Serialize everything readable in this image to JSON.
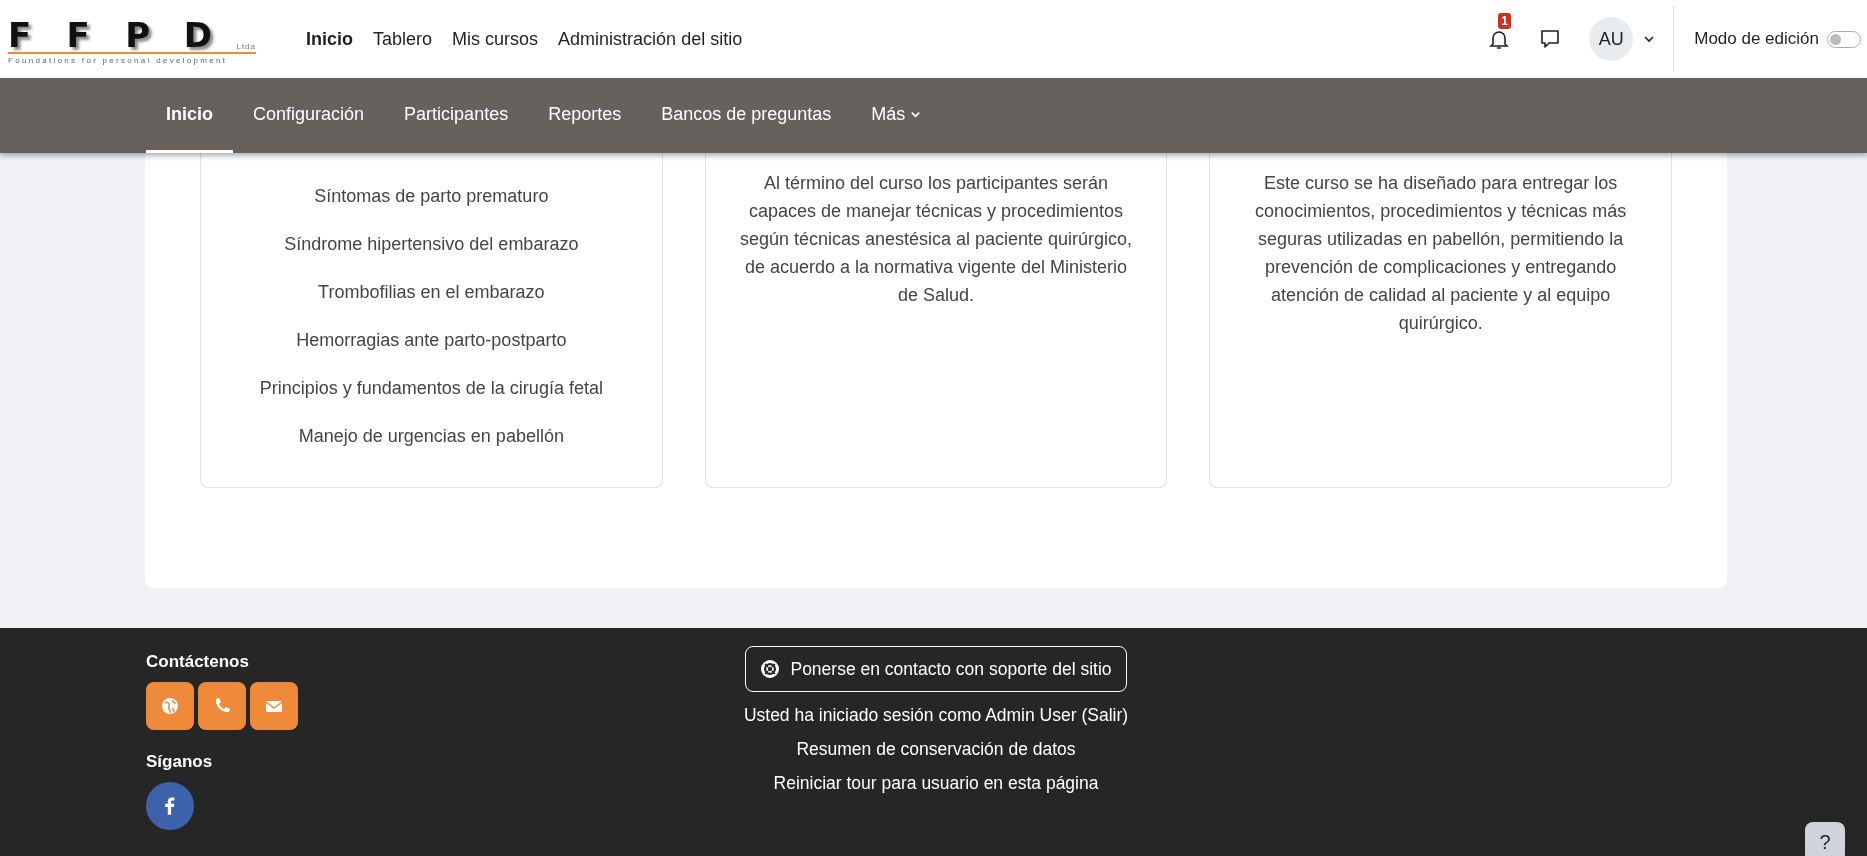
{
  "logo": {
    "letters": [
      "F",
      "F",
      "P",
      "D"
    ],
    "suffix": "Ltda",
    "tagline": "Foundations for personal development"
  },
  "primary_nav": [
    {
      "label": "Inicio",
      "selected": true
    },
    {
      "label": "Tablero",
      "selected": false
    },
    {
      "label": "Mis cursos",
      "selected": false
    },
    {
      "label": "Administración del sitio",
      "selected": false
    }
  ],
  "user_menu": {
    "notification_count": "1",
    "avatar": "AU",
    "edit_mode_label": "Modo de edición",
    "edit_mode_on": false
  },
  "secondary_nav": [
    {
      "label": "Inicio",
      "selected": true,
      "has_menu": false
    },
    {
      "label": "Configuración",
      "selected": false,
      "has_menu": false
    },
    {
      "label": "Participantes",
      "selected": false,
      "has_menu": false
    },
    {
      "label": "Reportes",
      "selected": false,
      "has_menu": false
    },
    {
      "label": "Bancos de preguntas",
      "selected": false,
      "has_menu": false
    },
    {
      "label": "Más",
      "selected": false,
      "has_menu": true
    }
  ],
  "cards": [
    {
      "kind": "list",
      "items": [
        "Síntomas de parto prematuro",
        "Síndrome hipertensivo del embarazo",
        "Trombofilias en el embarazo",
        "Hemorragias ante parto-postparto",
        "Principios y fundamentos de la cirugía fetal",
        "Manejo de urgencias en pabellón"
      ]
    },
    {
      "kind": "paragraph",
      "text": "Al término del curso los participantes serán capaces de manejar técnicas y procedimientos según técnicas anestésica al paciente quirúrgico, de acuerdo a la normativa vigente del Ministerio de Salud."
    },
    {
      "kind": "paragraph",
      "text": "Este curso se ha diseñado para entregar los conocimientos, procedimientos y técnicas más seguras utilizadas en pabellón,  permitiendo la prevención de complicaciones y entregando atención de calidad al paciente y al equipo quirúrgico."
    }
  ],
  "footer": {
    "contact_title": "Contáctenos",
    "contact_buttons": [
      {
        "kind": "web"
      },
      {
        "kind": "phone"
      },
      {
        "kind": "mail"
      }
    ],
    "follow_title": "Síganos",
    "social": [
      {
        "kind": "facebook"
      }
    ],
    "support_button": "Ponerse en contacto con soporte del sitio",
    "login_text": "Usted ha iniciado sesión como Admin User (",
    "logout_link": "Salir",
    "login_text_end": ")",
    "links": [
      "Resumen de conservación de datos",
      "Reiniciar tour para usuario en esta página"
    ],
    "help_button": "?"
  }
}
